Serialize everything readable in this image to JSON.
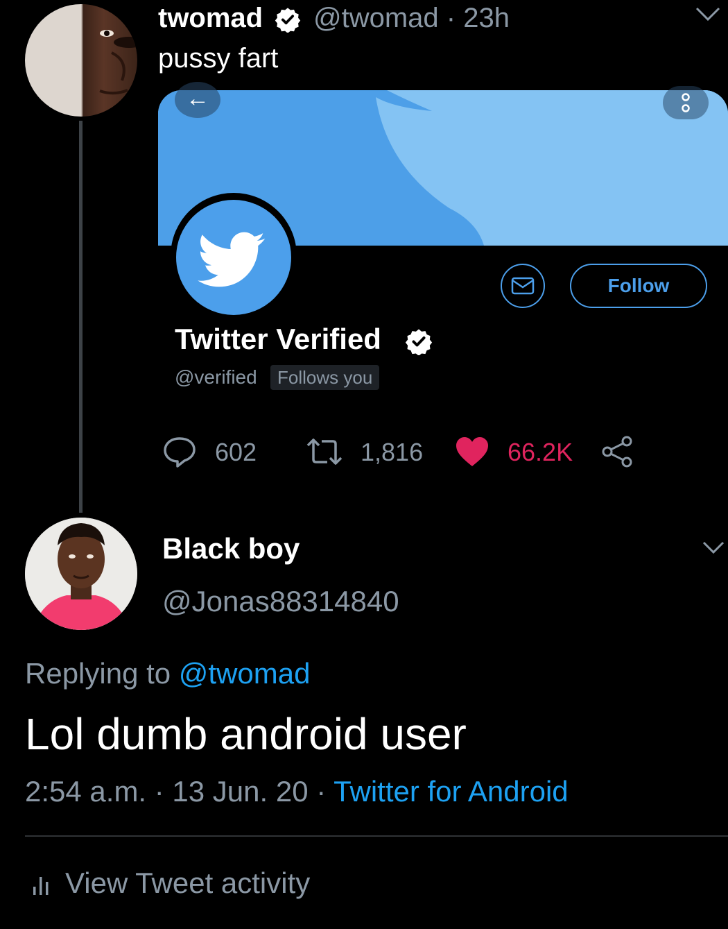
{
  "tweet": {
    "author": "twomad",
    "handle": "@twomad",
    "time": "· 23h",
    "text": "pussy fart",
    "avatar_icon": "twomad-avatar",
    "embedded_profile": {
      "name": "Twitter Verified",
      "handle": "@verified",
      "follows_you": "Follows you",
      "follow_label": "Follow",
      "avatar_icon": "twitter-bird-icon",
      "banner_color": "#84c3f3",
      "accent": "#4c9feb"
    },
    "stats": {
      "replies": "602",
      "retweets": "1,816",
      "likes": "66.2K"
    }
  },
  "reply": {
    "author": "Black boy",
    "handle": "@Jonas88314840",
    "replying_prefix": "Replying to ",
    "replying_to": "@twomad",
    "text": "Lol dumb android user",
    "timestamp": "2:54 a.m. · 13 Jun. 20 · ",
    "source": "Twitter for Android",
    "activity_label": "View Tweet activity"
  },
  "colors": {
    "background": "#000000",
    "muted_text": "#8b98a5",
    "link": "#1da1f2",
    "like": "#e0245e"
  }
}
